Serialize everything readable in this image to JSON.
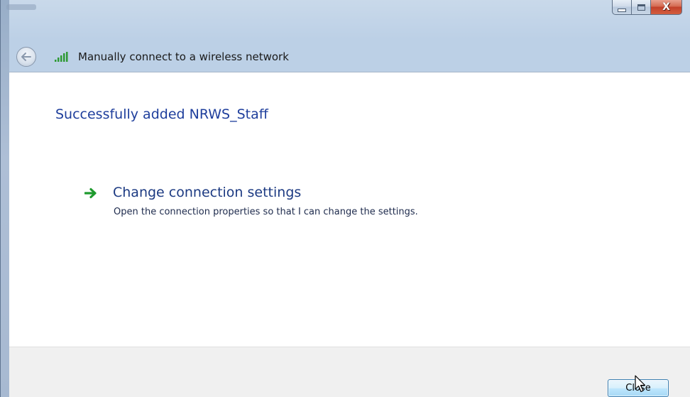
{
  "window": {
    "caption_buttons": {
      "minimize_icon": "minimize-icon",
      "maximize_icon": "maximize-icon",
      "close_glyph": "X"
    }
  },
  "header": {
    "back_icon": "back-arrow-icon",
    "network_icon": "wireless-signal-icon",
    "title": "Manually connect to a wireless network"
  },
  "content": {
    "success_message": "Successfully added NRWS_Staff",
    "change_settings": {
      "icon": "green-arrow-icon",
      "title": "Change connection settings",
      "description": "Open the connection properties so that I can change the settings."
    }
  },
  "footer": {
    "close_button_label": "Close"
  },
  "colors": {
    "accent_title": "#1e3e9c",
    "link_title": "#1c3a82",
    "close_caption_button": "#c2412a",
    "arrow_green": "#1f9a2e",
    "button_border": "#3c7fb1"
  }
}
